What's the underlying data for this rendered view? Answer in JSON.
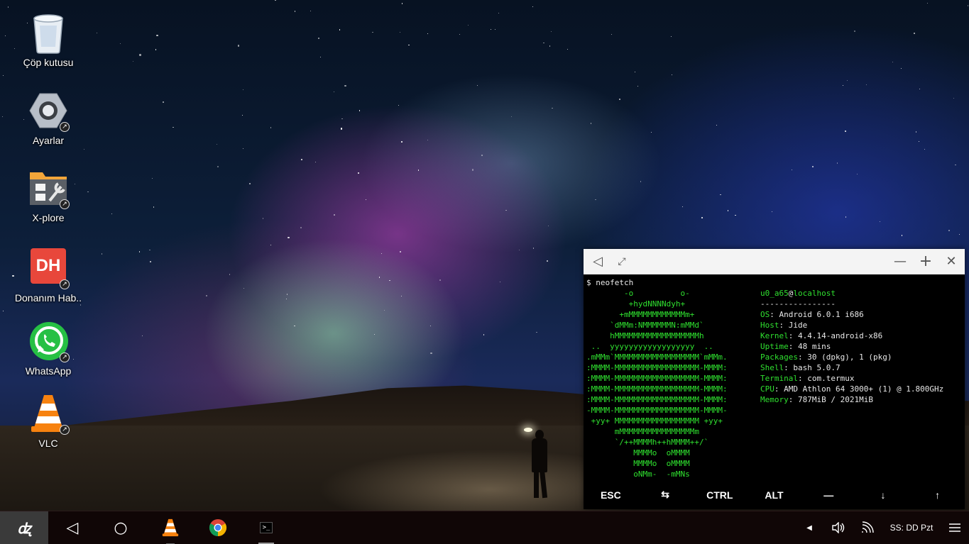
{
  "desktop": {
    "icons": [
      {
        "label": "Çöp kutusu",
        "icon": "trash-icon"
      },
      {
        "label": "Ayarlar",
        "icon": "settings-gear-icon"
      },
      {
        "label": "X-plore",
        "icon": "folder-tools-icon"
      },
      {
        "label": "Donanım Hab..",
        "icon": "dh-logo-icon",
        "logo_text": "DH"
      },
      {
        "label": "WhatsApp",
        "icon": "whatsapp-icon"
      },
      {
        "label": "VLC",
        "icon": "vlc-cone-icon"
      }
    ]
  },
  "terminal": {
    "prompt": "$ neofetch",
    "ascii_art": [
      "        -o          o-",
      "         +hydNNNNdyh+",
      "       +mMMMMMMMMMMMMm+",
      "     `dMMm:NMMMMMMN:mMMd`",
      "     hMMMMMMMMMMMMMMMMMMh",
      " ..  yyyyyyyyyyyyyyyyyy  ..",
      ".mMMm`MMMMMMMMMMMMMMMMMM`mMMm.",
      ":MMMM-MMMMMMMMMMMMMMMMMM-MMMM:",
      ":MMMM-MMMMMMMMMMMMMMMMMM-MMMM:",
      ":MMMM-MMMMMMMMMMMMMMMMMM-MMMM:",
      ":MMMM-MMMMMMMMMMMMMMMMMM-MMMM:",
      "-MMMM-MMMMMMMMMMMMMMMMMM-MMMM-",
      " +yy+ MMMMMMMMMMMMMMMMMM +yy+",
      "      mMMMMMMMMMMMMMMMMm",
      "      `/++MMMMh++hMMMM++/`",
      "          MMMMo  oMMMM",
      "          MMMMo  oMMMM",
      "          oNMm-  -mMNs"
    ],
    "userhost": {
      "user": "u0_a65",
      "at": "@",
      "host": "localhost"
    },
    "separator": "----------------",
    "info": [
      {
        "key": "OS",
        "value": "Android 6.0.1 i686"
      },
      {
        "key": "Host",
        "value": "Jide"
      },
      {
        "key": "Kernel",
        "value": "4.4.14-android-x86"
      },
      {
        "key": "Uptime",
        "value": "48 mins"
      },
      {
        "key": "Packages",
        "value": "30 (dpkg), 1 (pkg)"
      },
      {
        "key": "Shell",
        "value": "bash 5.0.7"
      },
      {
        "key": "Terminal",
        "value": "com.termux"
      },
      {
        "key": "CPU",
        "value": "AMD Athlon 64 3000+ (1) @ 1.800GHz"
      },
      {
        "key": "Memory",
        "value": "787MiB / 2021MiB"
      }
    ],
    "extra_keys": [
      "ESC",
      "⇆",
      "CTRL",
      "ALT",
      "—",
      "↓",
      "↑"
    ],
    "titlebar": {
      "back": "◁",
      "restore": "⤢",
      "minimize": "—",
      "maximize": "+",
      "close": "✕"
    }
  },
  "taskbar": {
    "start_label": "ꭦ",
    "clock": "SS: DD Pzt",
    "nav": {
      "back": "◁",
      "home": "○"
    }
  }
}
